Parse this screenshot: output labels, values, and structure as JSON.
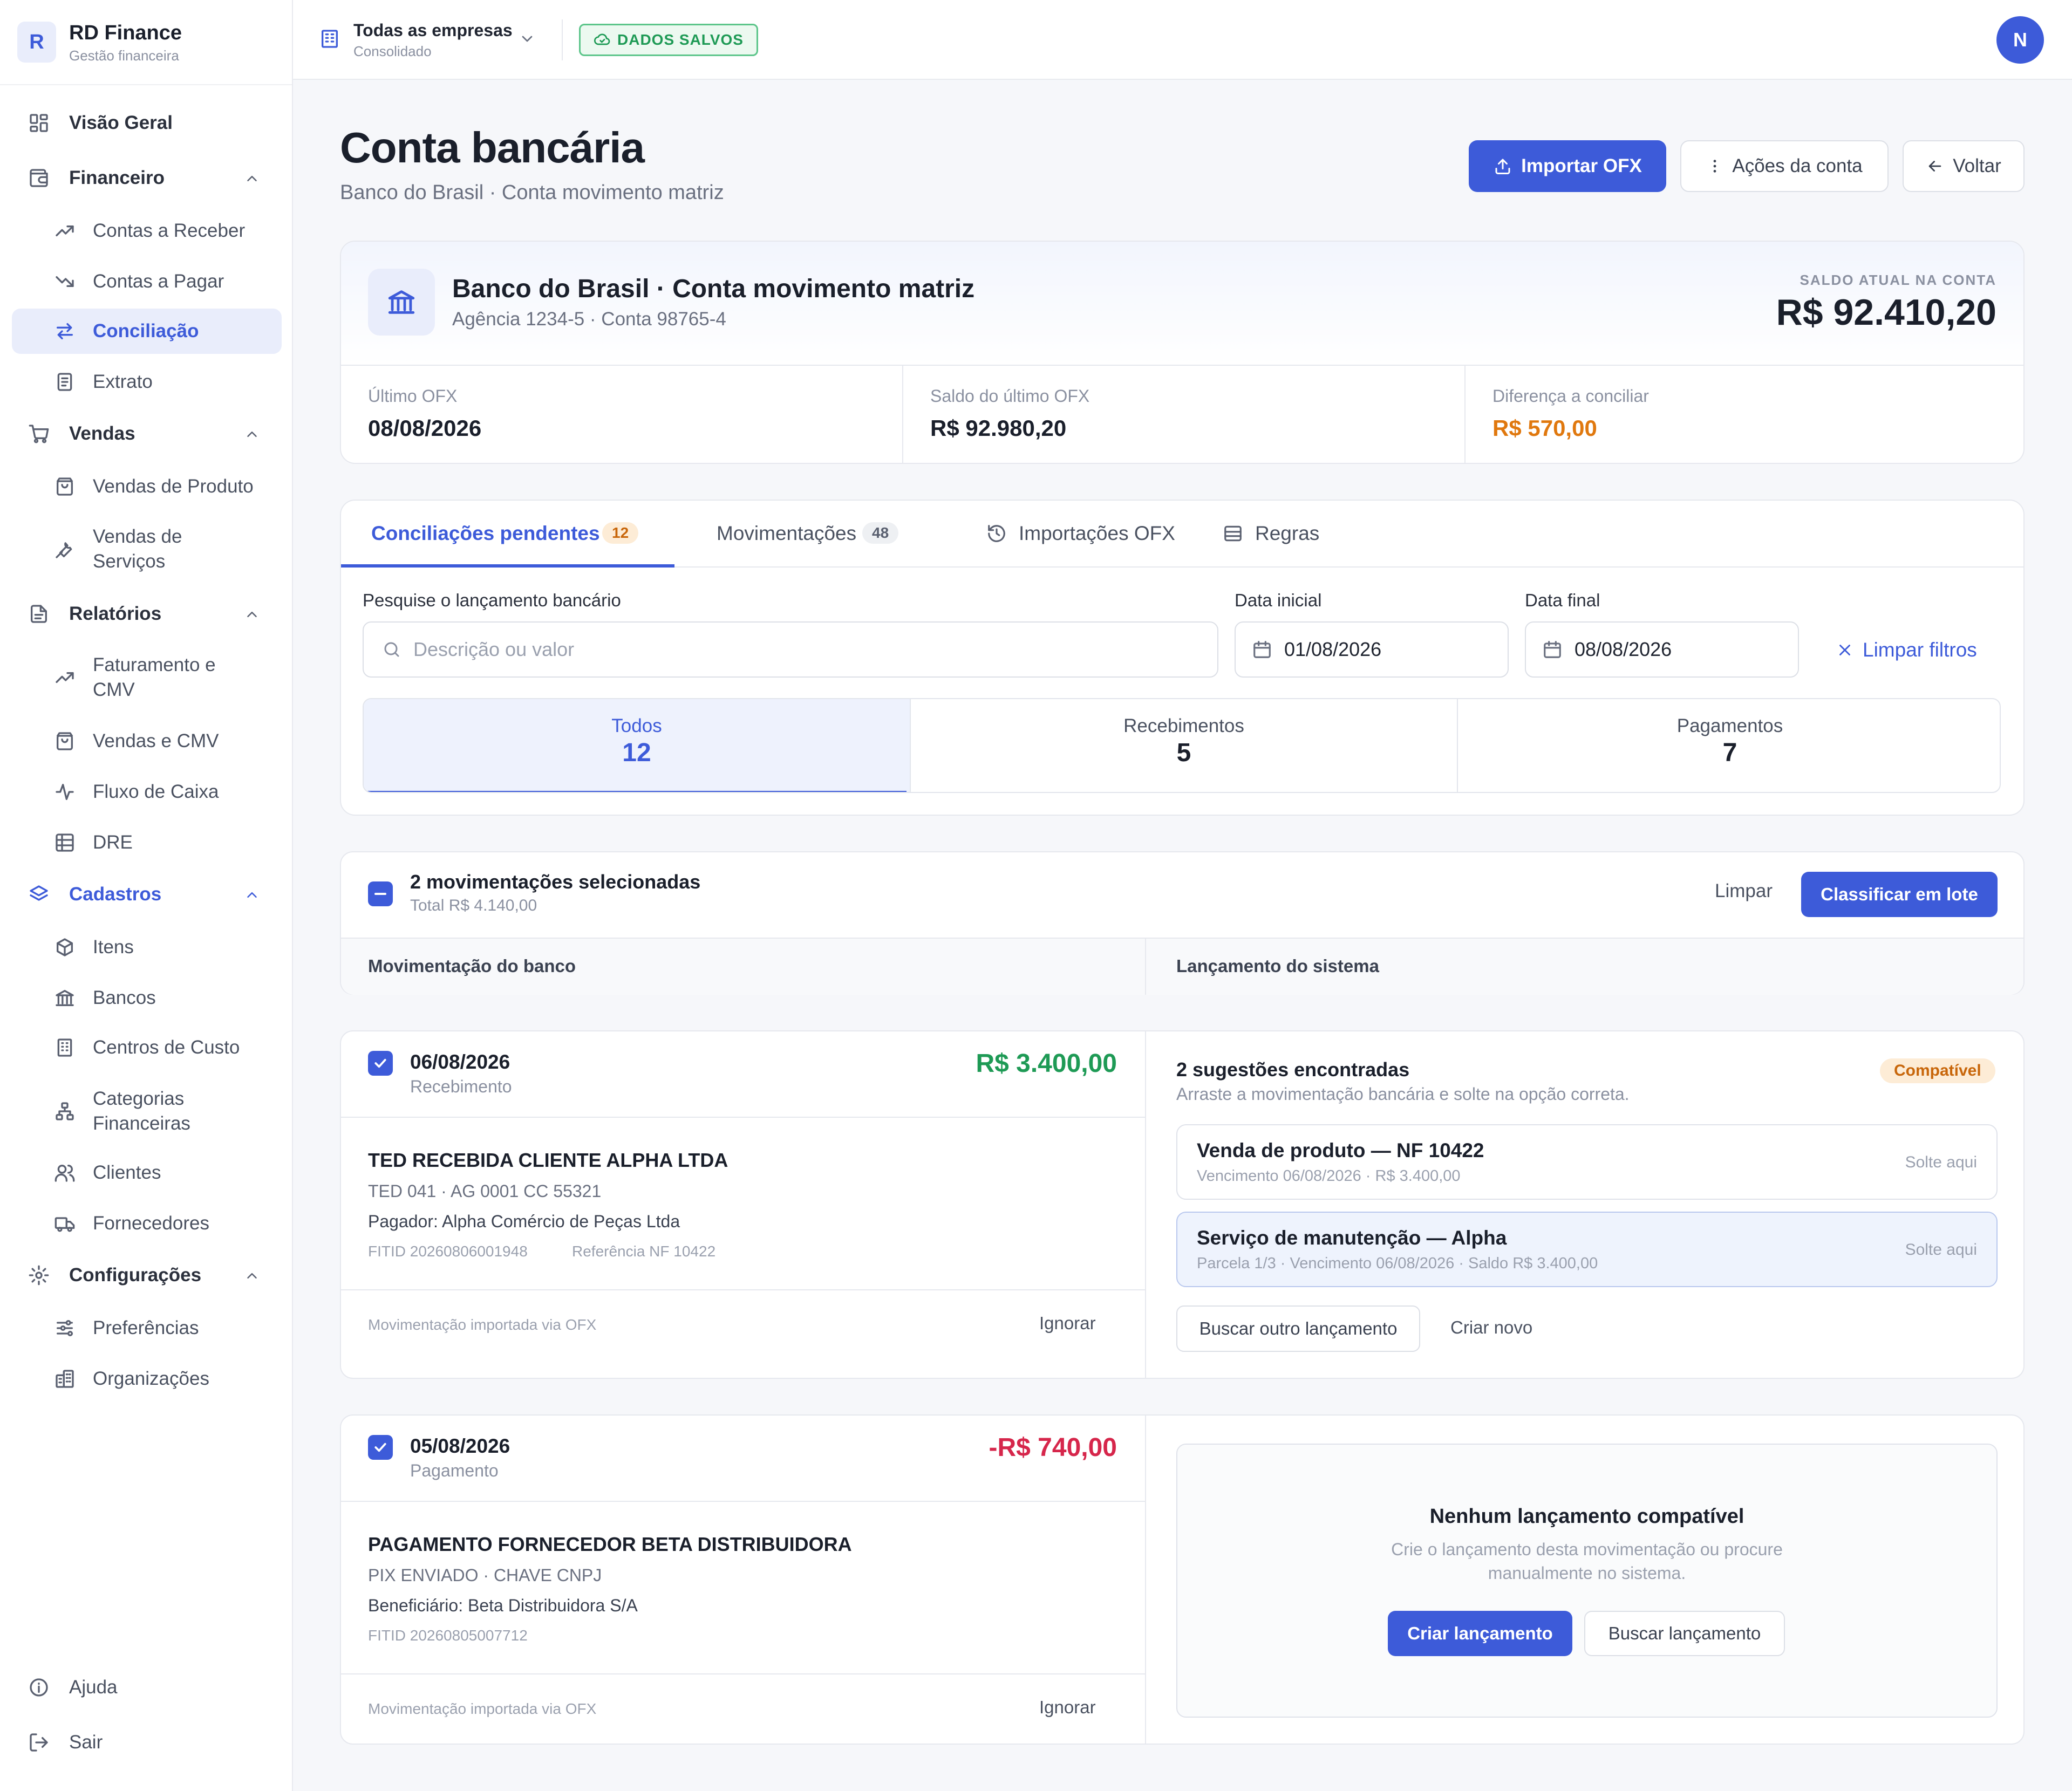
{
  "brand": {
    "initial": "R",
    "name": "RD Finance",
    "subtitle": "Gestão financeira"
  },
  "nav": {
    "visao_geral": "Visão Geral",
    "financeiro": "Financeiro",
    "contas_receber": "Contas a Receber",
    "contas_pagar": "Contas a Pagar",
    "conciliacao": "Conciliação",
    "extrato": "Extrato",
    "vendas": "Vendas",
    "vendas_produto": "Vendas de Produto",
    "vendas_servicos_1": "Vendas de",
    "vendas_servicos_2": "Serviços",
    "relatorios": "Relatórios",
    "faturamento_1": "Faturamento e",
    "faturamento_2": "CMV",
    "vendas_cmv": "Vendas e CMV",
    "fluxo_caixa": "Fluxo de Caixa",
    "dre": "DRE",
    "cadastros": "Cadastros",
    "itens": "Itens",
    "bancos": "Bancos",
    "centros_custo": "Centros de Custo",
    "categorias_1": "Categorias",
    "categorias_2": "Financeiras",
    "clientes": "Clientes",
    "fornecedores": "Fornecedores",
    "configuracoes": "Configurações",
    "preferencias": "Preferências",
    "organizacoes": "Organizações",
    "ajuda": "Ajuda",
    "sair": "Sair"
  },
  "topbar": {
    "company": "Todas as empresas",
    "company_sub": "Consolidado",
    "saved_badge": "DADOS SALVOS",
    "avatar": "N"
  },
  "page": {
    "title": "Conta bancária",
    "subtitle": "Banco do Brasil · Conta movimento matriz",
    "import_btn": "Importar OFX",
    "actions_btn": "Ações da conta",
    "back_btn": "Voltar"
  },
  "account": {
    "name": "Banco do Brasil · Conta movimento matriz",
    "details": "Agência 1234-5 · Conta 98765-4",
    "balance_label": "SALDO ATUAL NA CONTA",
    "balance": "R$ 92.410,20",
    "stats": [
      {
        "label": "Último OFX",
        "value": "08/08/2026"
      },
      {
        "label": "Saldo do último OFX",
        "value": "R$ 92.980,20"
      },
      {
        "label": "Diferença a conciliar",
        "value": "R$ 570,00"
      }
    ]
  },
  "tabs": [
    {
      "label": "Conciliações pendentes",
      "count": "12"
    },
    {
      "label": "Movimentações",
      "count": "48"
    },
    {
      "label": "Importações OFX"
    },
    {
      "label": "Regras"
    }
  ],
  "filters": {
    "search_label": "Pesquise o lançamento bancário",
    "search_placeholder": "Descrição ou valor",
    "start_label": "Data inicial",
    "start_value": "01/08/2026",
    "end_label": "Data final",
    "end_value": "08/08/2026",
    "clear": "Limpar filtros"
  },
  "segments": [
    {
      "label": "Todos",
      "count": "12"
    },
    {
      "label": "Recebimentos",
      "count": "5"
    },
    {
      "label": "Pagamentos",
      "count": "7"
    }
  ],
  "selection": {
    "title": "2 movimentações selecionadas",
    "total": "Total R$ 4.140,00",
    "clear": "Limpar",
    "batch": "Classificar em lote",
    "col_bank": "Movimentação do banco",
    "col_system": "Lançamento do sistema"
  },
  "transactions": [
    {
      "date": "06/08/2026",
      "type": "Recebimento",
      "amount": "R$ 3.400,00",
      "desc": "TED RECEBIDA CLIENTE ALPHA LTDA",
      "line1": "TED 041 · AG 0001 CC 55321",
      "line2": "Pagador: Alpha Comércio de Peças Ltda",
      "fitid": "FITID 20260806001948",
      "ref": "Referência NF 10422",
      "footer": "Movimentação importada via OFX",
      "ignore": "Ignorar",
      "match_title": "2 sugestões encontradas",
      "match_hint": "Arraste a movimentação bancária e solte na opção correta.",
      "match_badge": "Compatível",
      "suggestions": [
        {
          "title": "Venda de produto — NF 10422",
          "sub": "Vencimento 06/08/2026 · R$ 3.400,00",
          "drop": "Solte aqui"
        },
        {
          "title": "Serviço de manutenção — Alpha",
          "sub": "Parcela 1/3 · Vencimento 06/08/2026 · Saldo R$ 3.400,00",
          "drop": "Solte aqui"
        }
      ],
      "search_other": "Buscar outro lançamento",
      "create_new": "Criar novo"
    },
    {
      "date": "05/08/2026",
      "type": "Pagamento",
      "amount": "-R$ 740,00",
      "desc": "PAGAMENTO FORNECEDOR BETA DISTRIBUIDORA",
      "line1": "PIX ENVIADO · CHAVE CNPJ",
      "line2": "Beneficiário: Beta Distribuidora S/A",
      "fitid": "FITID 20260805007712",
      "footer": "Movimentação importada via OFX",
      "ignore": "Ignorar",
      "empty_title": "Nenhum lançamento compatível",
      "empty_text_1": "Crie o lançamento desta movimentação ou procure",
      "empty_text_2": "manualmente no sistema.",
      "create_btn": "Criar lançamento",
      "search_btn": "Buscar lançamento"
    }
  ],
  "colors": {
    "primary": "#3d5bd9",
    "positive": "#1e9a55",
    "negative": "#d6264b",
    "warning": "#e0780e"
  }
}
